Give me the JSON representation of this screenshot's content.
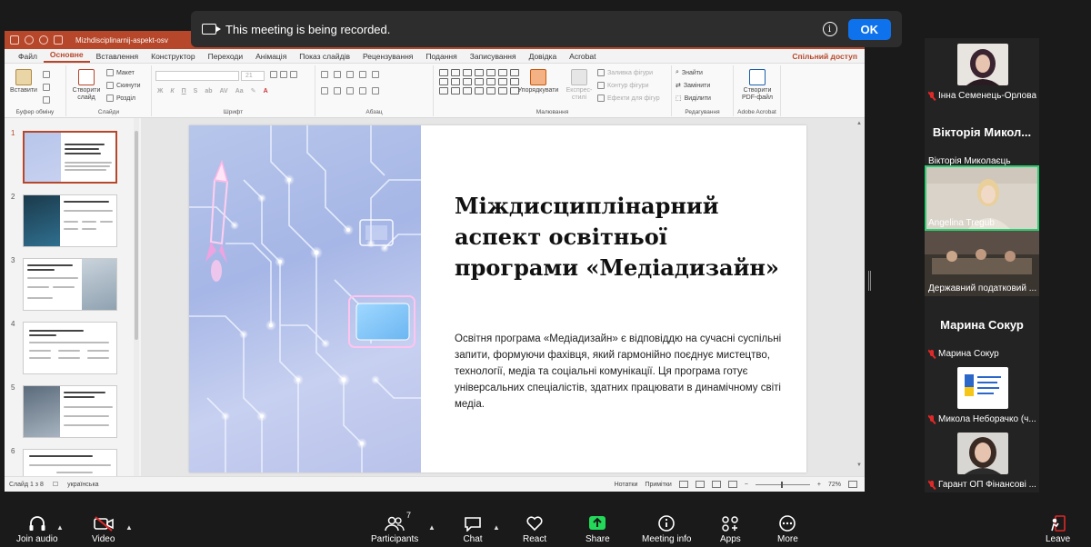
{
  "recording_banner": {
    "message": "This meeting is being recorded.",
    "info_icon": "info-icon",
    "ok_label": "OK"
  },
  "powerpoint": {
    "title_bar": {
      "file_name": "Mizhdisciplinarnij-aspekt-osv"
    },
    "menu": {
      "items": [
        "Файл",
        "Основне",
        "Вставлення",
        "Конструктор",
        "Переходи",
        "Анімація",
        "Показ слайдів",
        "Рецензування",
        "Подання",
        "Записування",
        "Довідка",
        "Acrobat"
      ],
      "active": "Основне",
      "share_label": "Спільний доступ"
    },
    "ribbon": {
      "clipboard": {
        "paste": "Вставити",
        "group": "Буфер обміну"
      },
      "slides": {
        "new_slide": "Створити слайд",
        "layout": "Макет",
        "reset": "Скинути",
        "section": "Розділ",
        "group": "Слайди"
      },
      "font": {
        "size": "21",
        "group": "Шрифт"
      },
      "paragraph": {
        "group": "Абзац"
      },
      "drawing": {
        "arrange": "Упорядкувати",
        "quick_styles": "Експрес-стилі",
        "fill": "Заливка фігури",
        "outline": "Контур фігури",
        "effects": "Ефекти для фігур",
        "group": "Малювання"
      },
      "editing": {
        "find": "Знайти",
        "replace": "Замінити",
        "select": "Виділити",
        "group": "Редагування"
      },
      "acrobat": {
        "create_pdf": "Створити PDF-файл",
        "group": "Adobe Acrobat"
      }
    },
    "thumbnails": {
      "numbers": [
        "1",
        "2",
        "3",
        "4",
        "5",
        "6"
      ],
      "selected": "1",
      "titles": [
        "Міждисциплінарний аспект освітньої програми «Медіадизайн»",
        "Взаємодія медіа та комунікацій",
        "Візуальні мистецтво та креативність",
        "Соціальні комунікації та платформи",
        "Креативність та цифрові стратегії",
        "Міжвідомчі зв'язки: дизайн-менеджмент"
      ]
    },
    "slide": {
      "title": "Міждисциплінарний аспект освітньої програми «Медіадизайн»",
      "body": "Освітня програма «Медіадизайн» є відповіддю на сучасні суспільні запити, формуючи фахівця, який гармонійно поєднує мистецтво, технології, медіа та соціальні комунікації. Ця програма готує універсальних спеціалістів, здатних працювати в динамічному світі медіа."
    },
    "status_bar": {
      "slide_counter": "Слайд 1 з 8",
      "language": "українська",
      "notes": "Нотатки",
      "comments": "Примітки",
      "zoom": "72%"
    }
  },
  "participants": [
    {
      "name": "Інна Семенець-Орлова",
      "muted": true,
      "type": "avatar"
    },
    {
      "display_name": "Вікторія Микол...",
      "name": "Вікторія Миколаєць",
      "muted": false,
      "type": "name"
    },
    {
      "name": "Angelina Tregub",
      "muted": false,
      "type": "video",
      "active": true
    },
    {
      "name": "Державний податковий ...",
      "muted": false,
      "type": "video"
    },
    {
      "display_name": "Марина Сокур",
      "name": "Марина Сокур",
      "muted": true,
      "type": "name"
    },
    {
      "name": "Микола Неборачко (ч...",
      "muted": true,
      "type": "avatar"
    },
    {
      "name": "Гарант ОП Фінансові ...",
      "muted": true,
      "type": "avatar"
    }
  ],
  "toolbar": {
    "join_audio": "Join audio",
    "video": "Video",
    "participants": "Participants",
    "participants_count": "7",
    "chat": "Chat",
    "react": "React",
    "share": "Share",
    "meeting_info": "Meeting info",
    "apps": "Apps",
    "more": "More",
    "leave": "Leave"
  },
  "colors": {
    "ppt_accent": "#b7472a",
    "zoom_blue": "#0e72ed",
    "share_green": "#23d959",
    "active_speaker": "#2ecc71",
    "muted_red": "#e02828"
  }
}
